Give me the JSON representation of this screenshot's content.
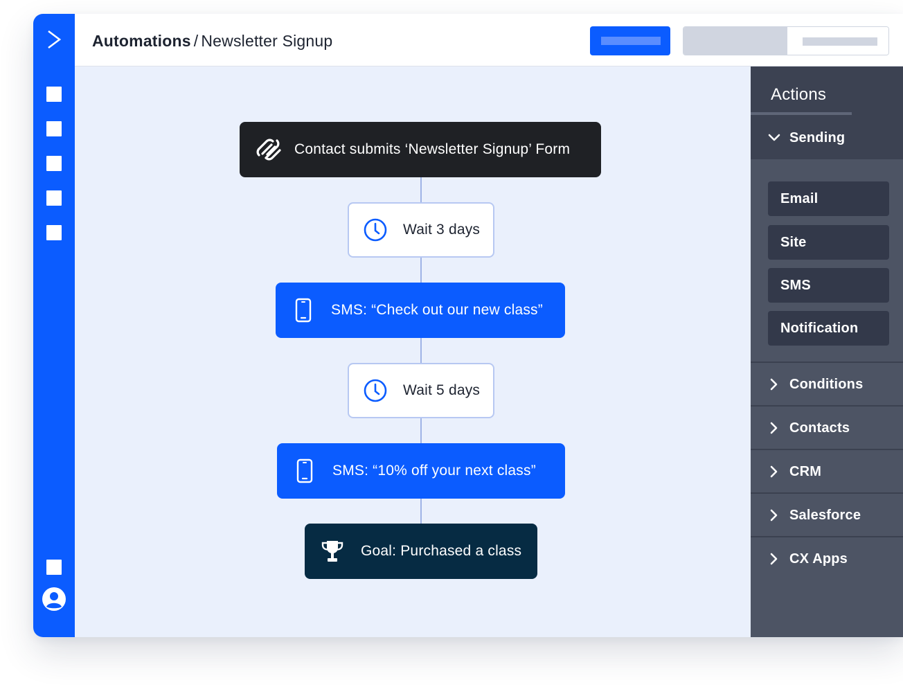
{
  "header": {
    "breadcrumb_root": "Automations",
    "breadcrumb_separator": "/",
    "breadcrumb_current": "Newsletter Signup"
  },
  "workflow": {
    "trigger": "Contact submits ‘Newsletter Signup’ Form",
    "wait1": "Wait 3 days",
    "sms1": "SMS: “Check out our new class”",
    "wait2": "Wait 5 days",
    "sms2": "SMS: “10% off your next class”",
    "goal": "Goal: Purchased a class"
  },
  "actions_panel": {
    "title": "Actions",
    "sending": {
      "label": "Sending",
      "expanded": true,
      "items": [
        "Email",
        "Site",
        "SMS",
        "Notification"
      ]
    },
    "categories": [
      "Conditions",
      "Contacts",
      "CRM",
      "Salesforce",
      "CX Apps"
    ]
  },
  "icons": {
    "rail_logo": "chevron-right-logo-icon",
    "trigger": "squarespace-icon",
    "wait": "clock-icon",
    "sms": "mobile-phone-icon",
    "goal": "trophy-icon",
    "avatar": "user-avatar-icon"
  },
  "colors": {
    "brand_blue": "#0b5cff",
    "canvas_bg": "#eaf0fc",
    "trigger_bg": "#1f2125",
    "goal_bg": "#062b43",
    "panel_bg": "#4d5464"
  }
}
